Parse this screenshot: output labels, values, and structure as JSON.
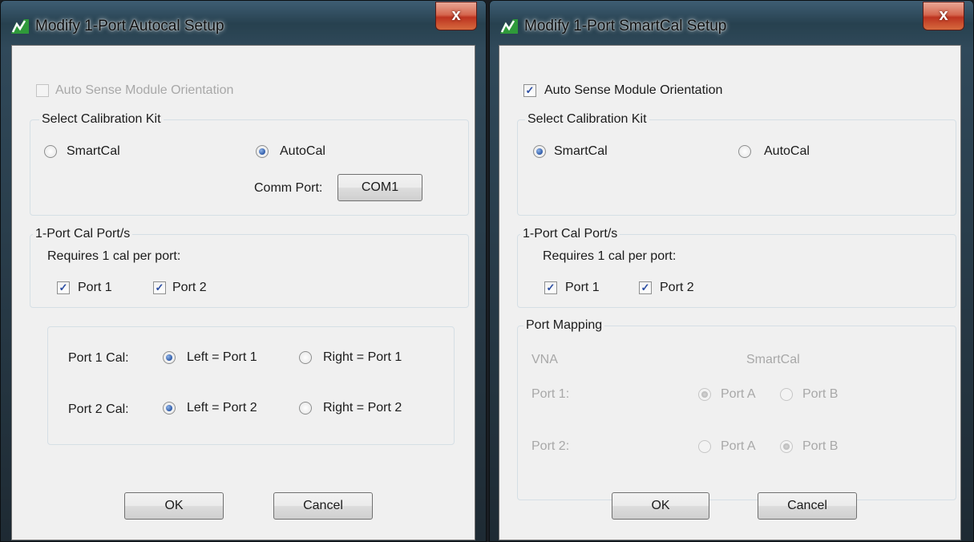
{
  "left_dialog": {
    "title": "Modify 1-Port Autocal Setup",
    "close_glyph": "x",
    "auto_sense": {
      "label": "Auto Sense Module Orientation",
      "checked": false,
      "enabled": false
    },
    "cal_kit": {
      "group_title": "Select Calibration Kit",
      "smartcal_label": "SmartCal",
      "autocal_label": "AutoCal",
      "selected": "AutoCal",
      "comm_port_label": "Comm Port:",
      "comm_port_value": "COM1"
    },
    "ports": {
      "group_title": "1-Port Cal Port/s",
      "requires_text": "Requires 1 cal per port:",
      "port1_label": "Port 1",
      "port2_label": "Port 2",
      "port1_checked": true,
      "port2_checked": true
    },
    "orientation": {
      "port1_cal_label": "Port 1 Cal:",
      "port1_left": "Left = Port 1",
      "port1_right": "Right = Port 1",
      "port1_selected": "left",
      "port2_cal_label": "Port 2 Cal:",
      "port2_left": "Left = Port 2",
      "port2_right": "Right = Port 2",
      "port2_selected": "left"
    },
    "ok_label": "OK",
    "cancel_label": "Cancel"
  },
  "right_dialog": {
    "title": "Modify 1-Port SmartCal Setup",
    "close_glyph": "x",
    "auto_sense": {
      "label": "Auto Sense Module Orientation",
      "checked": true,
      "enabled": true
    },
    "cal_kit": {
      "group_title": "Select Calibration Kit",
      "smartcal_label": "SmartCal",
      "autocal_label": "AutoCal",
      "selected": "SmartCal"
    },
    "ports": {
      "group_title": "1-Port Cal Port/s",
      "requires_text": "Requires 1 cal per port:",
      "port1_label": "Port 1",
      "port2_label": "Port 2",
      "port1_checked": true,
      "port2_checked": true
    },
    "port_mapping": {
      "group_title": "Port Mapping",
      "enabled": false,
      "vna_header": "VNA",
      "smartcal_header": "SmartCal",
      "port1_label": "Port 1:",
      "port2_label": "Port 2:",
      "port_a_label": "Port A",
      "port_b_label": "Port B",
      "port1_selected": "Port A",
      "port2_selected": "Port B"
    },
    "ok_label": "OK",
    "cancel_label": "Cancel"
  }
}
